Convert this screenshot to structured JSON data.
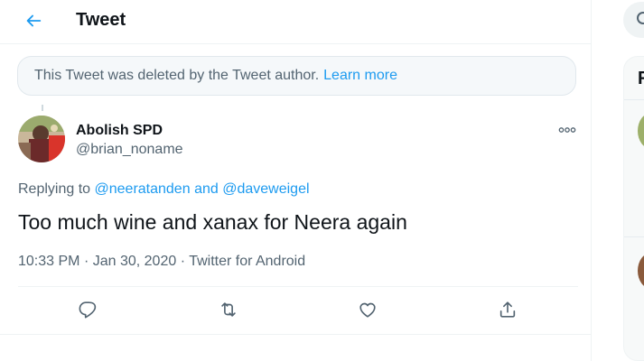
{
  "header": {
    "title": "Tweet",
    "back_icon": "arrow-left-icon"
  },
  "notice": {
    "text": "This Tweet was deleted by the Tweet author.",
    "link": "Learn more"
  },
  "tweet": {
    "display_name": "Abolish SPD",
    "handle": "@brian_noname",
    "replying_prefix": "Replying to",
    "replying_user_1": "@neeratanden",
    "replying_and": "and",
    "replying_user_2": "@daveweigel",
    "text": "Too much wine and xanax for Neera again",
    "time": "10:33 PM",
    "separator": "·",
    "date": "Jan 30, 2020",
    "source": "Twitter for Android"
  },
  "actions": [
    {
      "name": "reply",
      "icon": "reply-icon"
    },
    {
      "name": "retweet",
      "icon": "retweet-icon"
    },
    {
      "name": "like",
      "icon": "heart-icon"
    },
    {
      "name": "share",
      "icon": "share-icon"
    }
  ],
  "sidebar": {
    "heading_fragment": "R"
  },
  "colors": {
    "accent": "#1d9bf0",
    "text_primary": "#0f1419",
    "text_secondary": "#536471",
    "notice_bg": "#f5f8fa",
    "border": "#eff3f4"
  }
}
